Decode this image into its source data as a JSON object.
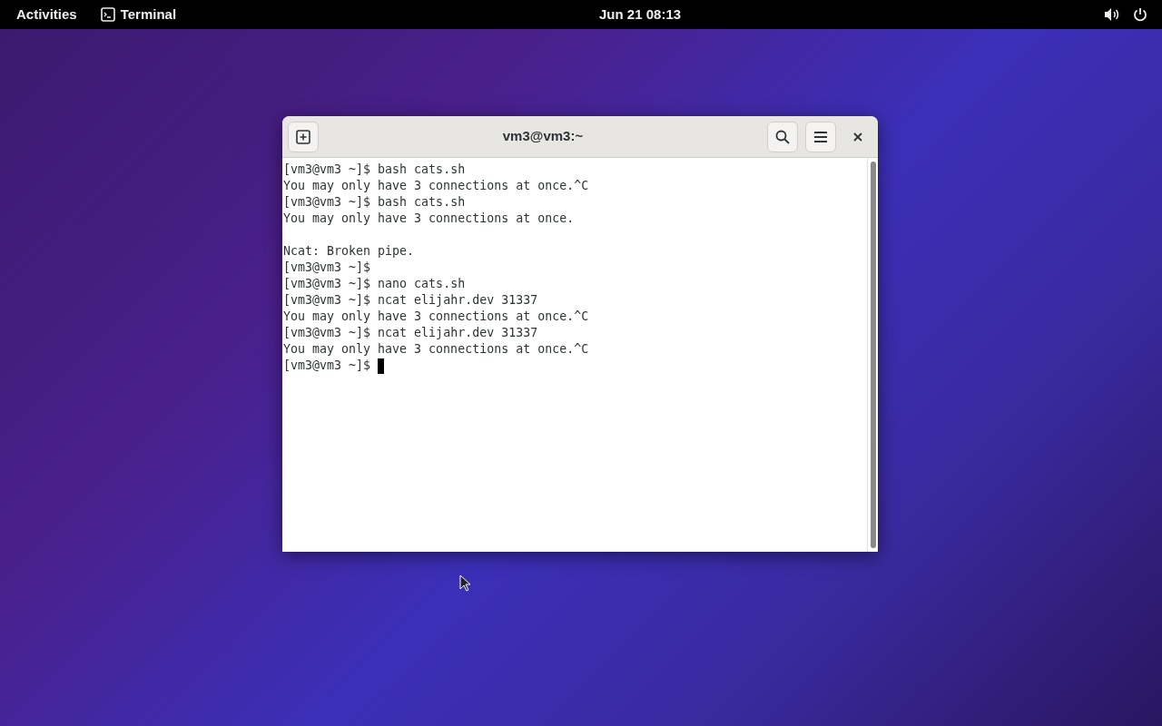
{
  "top_bar": {
    "activities": "Activities",
    "app": "Terminal",
    "clock": "Jun 21  08:13"
  },
  "terminal": {
    "title": "vm3@vm3:~",
    "lines": [
      {
        "kind": "prompt",
        "prompt": "[vm3@vm3 ~]$",
        "command": "bash cats.sh"
      },
      {
        "kind": "output",
        "text": "You may only have 3 connections at once.^C"
      },
      {
        "kind": "prompt",
        "prompt": "[vm3@vm3 ~]$",
        "command": "bash cats.sh"
      },
      {
        "kind": "output",
        "text": "You may only have 3 connections at once."
      },
      {
        "kind": "blank"
      },
      {
        "kind": "output",
        "text": "Ncat: Broken pipe."
      },
      {
        "kind": "prompt",
        "prompt": "[vm3@vm3 ~]$"
      },
      {
        "kind": "prompt",
        "prompt": "[vm3@vm3 ~]$",
        "command": "nano cats.sh"
      },
      {
        "kind": "prompt",
        "prompt": "[vm3@vm3 ~]$",
        "command": "ncat elijahr.dev 31337"
      },
      {
        "kind": "output",
        "text": "You may only have 3 connections at once.^C"
      },
      {
        "kind": "prompt",
        "prompt": "[vm3@vm3 ~]$",
        "command": "ncat elijahr.dev 31337"
      },
      {
        "kind": "output",
        "text": "You may only have 3 connections at once.^C"
      },
      {
        "kind": "active_prompt",
        "prompt": "[vm3@vm3 ~]$"
      }
    ]
  }
}
